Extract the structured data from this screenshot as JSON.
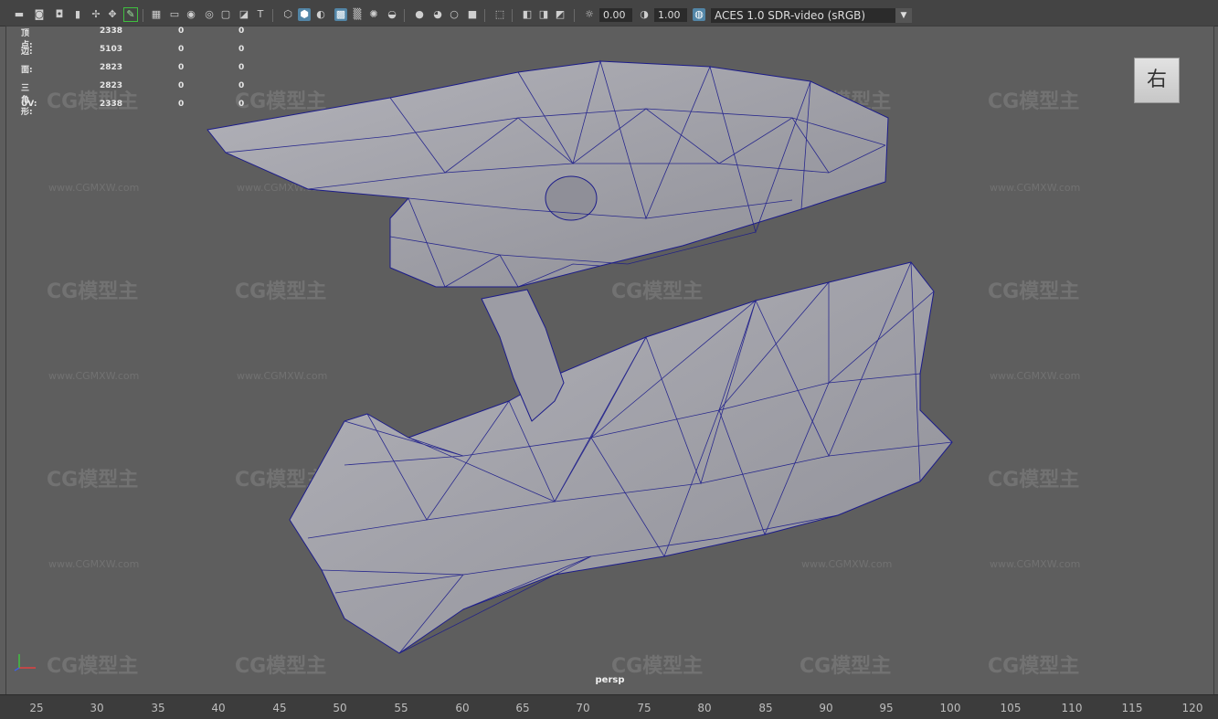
{
  "toolbar": {
    "exposure_value": "0.00",
    "gamma_value": "1.00",
    "color_space": "ACES 1.0 SDR-video (sRGB)"
  },
  "hud": {
    "rows": [
      {
        "label": "顶点:",
        "v1": "2338",
        "v2": "0",
        "v3": "0"
      },
      {
        "label": "边:",
        "v1": "5103",
        "v2": "0",
        "v3": "0"
      },
      {
        "label": "面:",
        "v1": "2823",
        "v2": "0",
        "v3": "0"
      },
      {
        "label": "三角形:",
        "v1": "2823",
        "v2": "0",
        "v3": "0"
      },
      {
        "label": "UV:",
        "v1": "2338",
        "v2": "0",
        "v3": "0"
      }
    ]
  },
  "viewcube": {
    "label": "右"
  },
  "camera": {
    "name": "persp"
  },
  "timeline": {
    "ticks": [
      "25",
      "30",
      "35",
      "40",
      "45",
      "50",
      "55",
      "60",
      "65",
      "70",
      "75",
      "80",
      "85",
      "90",
      "95",
      "100",
      "105",
      "110",
      "115",
      "120"
    ]
  },
  "watermark": {
    "logo": "CG模型主",
    "url": "www.CGMXW.com"
  },
  "colors": {
    "mesh_fill": "#a9a9b0",
    "wireframe": "#1c1c8a",
    "selected_tool": "#5285a6"
  },
  "icons": [
    "move-icon",
    "camera-icon",
    "bookmark-icon",
    "snap-icon",
    "pencil-icon",
    "grid-icon",
    "wireframe-icon",
    "shaded-icon",
    "texture-icon",
    "light-icon",
    "shadow-icon",
    "isolate-icon",
    "exposure-icon",
    "gamma-icon",
    "colorspace-icon"
  ]
}
